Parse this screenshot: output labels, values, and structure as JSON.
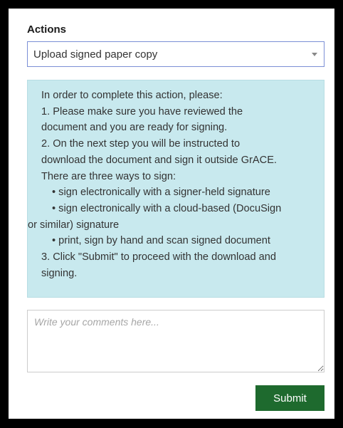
{
  "actions": {
    "label": "Actions",
    "selected": "Upload signed paper copy"
  },
  "instructions": {
    "lines": [
      "In order to complete this action, please:",
      "1. Please make sure you have reviewed the",
      "document and you are ready for signing.",
      "2. On the next step you will be instructed to",
      "download the document and sign it outside GrACE.",
      "There are three ways to sign:",
      "• sign electronically with a signer-held signature",
      "• sign electronically with a cloud-based (DocuSign",
      "or similar) signature",
      "• print, sign by hand and scan signed document",
      "3. Click \"Submit\" to proceed with the download and",
      "signing."
    ]
  },
  "comments": {
    "placeholder": "Write your comments here..."
  },
  "submit": {
    "label": "Submit"
  },
  "colors": {
    "info_background": "#c8e9ee",
    "submit_background": "#1e6a2e",
    "select_border": "#7b8fd6"
  }
}
